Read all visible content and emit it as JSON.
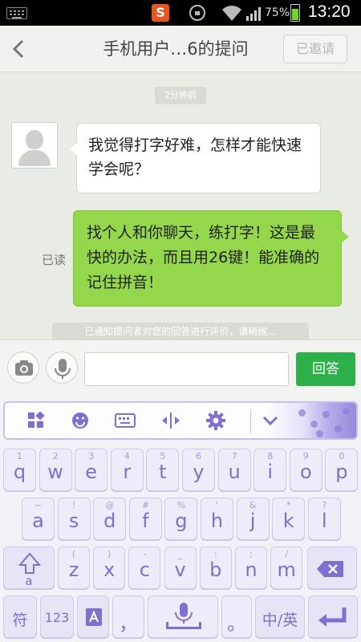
{
  "status_bar": {
    "battery": "75%",
    "time": "13:20",
    "app_badge": "S",
    "battery_level": 0.75
  },
  "header": {
    "title": "手机用户…6的提问",
    "invited_label": "已邀请"
  },
  "chat": {
    "timestamp": "2分钟前",
    "incoming_message": "我觉得打字好难，怎样才能快速学会呢？",
    "outgoing_message": "找个人和你聊天，练打字！这是最快的办法，而且用26键！能准确的记住拼音！",
    "read_status": "已读",
    "system_note": "已通知提问者对您的回答进行评价，请稍候..."
  },
  "input_bar": {
    "text_value": "",
    "answer_label": "回答"
  },
  "keyboard": {
    "row1": [
      {
        "main": "q",
        "sub": "1"
      },
      {
        "main": "w",
        "sub": "2"
      },
      {
        "main": "e",
        "sub": "3"
      },
      {
        "main": "r",
        "sub": "4"
      },
      {
        "main": "t",
        "sub": "5"
      },
      {
        "main": "y",
        "sub": "6"
      },
      {
        "main": "u",
        "sub": "7"
      },
      {
        "main": "i",
        "sub": "8"
      },
      {
        "main": "o",
        "sub": "9"
      },
      {
        "main": "p",
        "sub": "0"
      }
    ],
    "row2": [
      {
        "main": "a",
        "sub": "~"
      },
      {
        "main": "s",
        "sub": "!"
      },
      {
        "main": "d",
        "sub": "@"
      },
      {
        "main": "f",
        "sub": "#"
      },
      {
        "main": "g",
        "sub": "%"
      },
      {
        "main": "h",
        "sub": "'"
      },
      {
        "main": "j",
        "sub": "&"
      },
      {
        "main": "k",
        "sub": "*"
      },
      {
        "main": "l",
        "sub": "?"
      }
    ],
    "row3": [
      {
        "main": "z",
        "sub": "("
      },
      {
        "main": "x",
        "sub": ")"
      },
      {
        "main": "c",
        "sub": "-"
      },
      {
        "main": "v",
        "sub": "_"
      },
      {
        "main": "b",
        "sub": ":"
      },
      {
        "main": "n",
        "sub": ";"
      },
      {
        "main": "m",
        "sub": "/"
      }
    ],
    "shift_sub": "a",
    "symbols_label": "符",
    "numbers_label": "123",
    "comma_label": "，",
    "period_label": "。",
    "lang_label": "中/英"
  },
  "colors": {
    "accent_green": "#2db04a",
    "bubble_green": "#94d74c",
    "keyboard_purple": "#7f6fd1"
  }
}
